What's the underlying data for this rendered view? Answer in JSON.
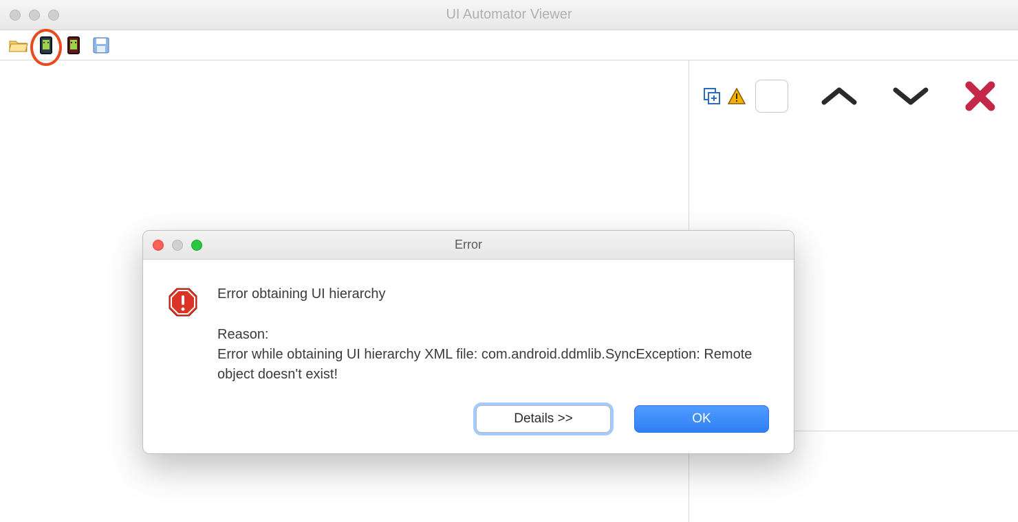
{
  "window": {
    "title": "UI Automator Viewer"
  },
  "toolbar": {
    "icons": {
      "open": "open-folder-icon",
      "screenshot": "device-screenshot-icon",
      "screenshot_compressed": "device-screenshot-compressed-icon",
      "save": "save-icon"
    }
  },
  "right_panel": {
    "icons": {
      "expand": "expand-all-icon",
      "warning": "warning-icon",
      "up": "chevron-up-icon",
      "down": "chevron-down-icon",
      "clear": "clear-x-icon"
    },
    "search_value": ""
  },
  "dialog": {
    "title": "Error",
    "heading": "Error obtaining UI hierarchy",
    "reason_label": "Reason:",
    "reason_text": "Error while obtaining UI hierarchy XML file: com.android.ddmlib.SyncException: Remote object doesn't exist!",
    "buttons": {
      "details": "Details >>",
      "ok": "OK"
    }
  }
}
